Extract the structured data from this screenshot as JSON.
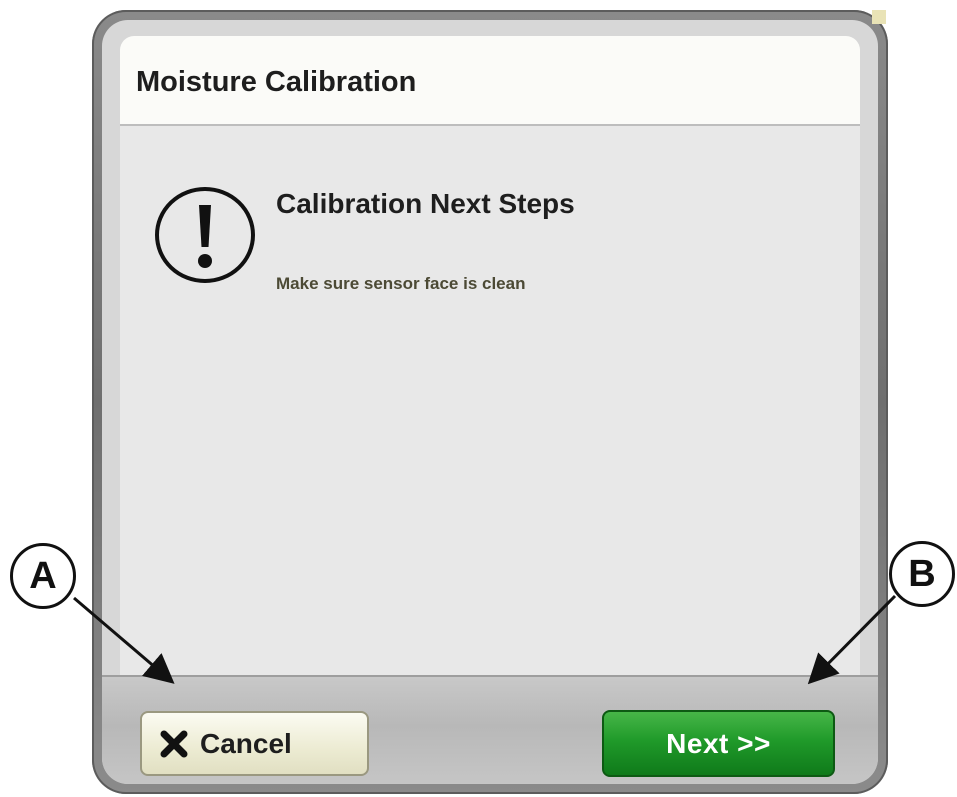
{
  "dialog": {
    "title": "Moisture Calibration",
    "heading": "Calibration Next Steps",
    "message": "Make sure sensor face is clean",
    "icon": "exclamation-circle-icon"
  },
  "footer": {
    "cancel_label": "Cancel",
    "cancel_icon": "close-x-icon",
    "next_label": "Next >>",
    "next_color": "#1f9a29"
  },
  "callouts": {
    "a_label": "A",
    "b_label": "B"
  }
}
